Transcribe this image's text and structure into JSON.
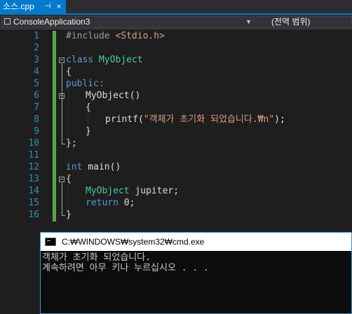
{
  "tab": {
    "title": "소스.cpp",
    "pin_glyph": "⊣",
    "close_glyph": "×"
  },
  "navbar": {
    "project": "ConsoleApplication3",
    "scope": "(전역 범위)"
  },
  "line_numbers": [
    "1",
    "2",
    "3",
    "4",
    "5",
    "6",
    "7",
    "8",
    "9",
    "10",
    "11",
    "12",
    "13",
    "14",
    "15",
    "16"
  ],
  "code": {
    "l1_inc": "#include ",
    "l1_hdr": "<Stdio.h>",
    "l3_kw": "class ",
    "l3_name": "MyObject",
    "l4": "{",
    "l5": "public:",
    "l6": "MyObject()",
    "l7": "{",
    "l8_pre": "printf(",
    "l8_str": "\"객체가 초기화 되었습니다.₩n\"",
    "l8_post": ");",
    "l9": "}",
    "l10": "};",
    "l12_kw": "int",
    "l12_rest": " main()",
    "l13": "{",
    "l14_type": "MyObject",
    "l14_rest": " jupiter;",
    "l15_kw": "return",
    "l15_rest": " 0;",
    "l16": "}"
  },
  "console": {
    "title": "C:₩WINDOWS₩system32₩cmd.exe",
    "lines": [
      "객체가 초기화 되었습니다.",
      "계속하려면 아무 키나 누르십시오 . . ."
    ]
  }
}
